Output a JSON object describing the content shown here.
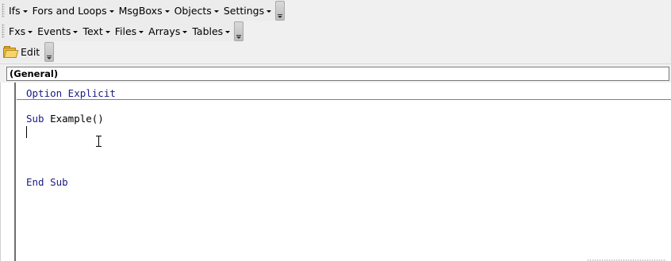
{
  "toolbars": {
    "row1": {
      "menus": [
        {
          "label": "Ifs"
        },
        {
          "label": "Fors and Loops"
        },
        {
          "label": "MsgBoxs"
        },
        {
          "label": "Objects"
        },
        {
          "label": "Settings"
        }
      ]
    },
    "row2": {
      "menus": [
        {
          "label": "Fxs"
        },
        {
          "label": "Events"
        },
        {
          "label": "Text"
        },
        {
          "label": "Files"
        },
        {
          "label": "Arrays"
        },
        {
          "label": "Tables"
        }
      ]
    },
    "row3": {
      "icon": "folder-icon",
      "edit_label": "Edit"
    }
  },
  "object_combo": {
    "value": "(General)"
  },
  "code": {
    "declarations": [
      {
        "keyword": "Option",
        "rest": " Explicit"
      }
    ],
    "procedure": {
      "sub_keyword": "Sub",
      "name": " Example()",
      "end_keyword": "End Sub"
    }
  },
  "colors": {
    "keyword": "#1a1a8a",
    "background": "#ffffff",
    "toolbar": "#ececec"
  }
}
